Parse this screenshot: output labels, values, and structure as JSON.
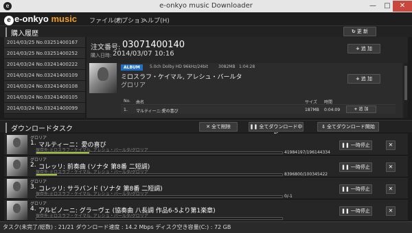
{
  "window": {
    "title": "e-onkyo music Downloader"
  },
  "logo": {
    "prefix": "e-onkyo",
    "suffix": "music"
  },
  "menu": [
    "ファイル(F)",
    "オプション",
    "ヘルプ(H)"
  ],
  "purchase_history": {
    "title": "購入履歴",
    "refresh_label": "更 新",
    "orders": [
      {
        "text": "2014/03/25  No.03251400167",
        "selected": false
      },
      {
        "text": "2014/03/25  No.03251400252",
        "selected": false
      },
      {
        "text": "2014/03/24  No.03241400222",
        "selected": false
      },
      {
        "text": "2014/03/24  No.03241400109",
        "selected": false
      },
      {
        "text": "2014/03/24  No.03241400108",
        "selected": false
      },
      {
        "text": "2014/03/24  No.03241400105",
        "selected": false
      },
      {
        "text": "2014/03/24  No.03241400099",
        "selected": false
      }
    ],
    "order_number_label": "注文番号:",
    "order_number": "03071400140",
    "purchase_date_label": "購入日時:",
    "purchase_date": "2014/03/07  10:16",
    "add_label": "追 加",
    "album": {
      "badge": "ALBUM",
      "format": "5.0ch Dolby HD 96kHz/24bit",
      "size": "3082MB",
      "duration": "1:04:28",
      "title": "ミロスラフ・ケイマル, アレシュ・バールタ",
      "artist": "グロリア",
      "add_label": "追 加"
    },
    "tracks": {
      "headers": {
        "no": "No.",
        "name": "曲名",
        "size": "サイズ",
        "time": "時間"
      },
      "rows": [
        {
          "no": "1.",
          "name": "マルティーニ:愛の喜び",
          "size": "187MB",
          "time": "0:04:09",
          "add_label": "追 加"
        }
      ]
    }
  },
  "download": {
    "title": "ダウンロードタスク",
    "delete_all_label": "全て削除",
    "stop_all_label": "全てダウンロード中断",
    "start_all_label": "全てダウンロード開始",
    "pause_label": "一時停止",
    "tasks": [
      {
        "album": "グロリア",
        "number": "1.",
        "name": "マルティーニ：愛の喜び",
        "saveto": "保存先:ミロスラフ・ケイマル, アレシュ・バールタ/グロリア",
        "progress": 0.214,
        "bytes": "41984197/196144334"
      },
      {
        "album": "グロリア",
        "number": "2.",
        "name": "コレッリ: 前奏曲 (ソナタ 第8番 二短調)",
        "saveto": "保存先:ミロスラフ・ケイマル, アレシュ・バールタ/グロリア",
        "progress": 0.084,
        "bytes": "8396800/100345422"
      },
      {
        "album": "グロリア",
        "number": "3.",
        "name": "コレッリ: サラバンド (ソナタ 第8番 二短調)",
        "saveto": "保存先:ミロスラフ・ケイマル, アレシュ・バールタ/グロリア",
        "progress": 0.0,
        "bytes": "0/-1"
      },
      {
        "album": "グロリア",
        "number": "4.",
        "name": "アルビノーニ: グラーヴェ (協奏曲 八長調 作品6-5より第1楽章)",
        "saveto": "保存先:ミロスラフ・ケイマル, アレシュ・バールタ/グロリア",
        "progress": 0.0,
        "bytes": ""
      }
    ]
  },
  "status": {
    "text": "タスク(未完了/総数) : 21/21  ダウンロード速度 : 14.2 Mbps  ディスク空き容量(C:) : 72 GB"
  },
  "colors": {
    "progress": "#a7c93a",
    "badge": "#1f6fc5",
    "close": "#c9483d",
    "accent": "#f2a01c"
  }
}
